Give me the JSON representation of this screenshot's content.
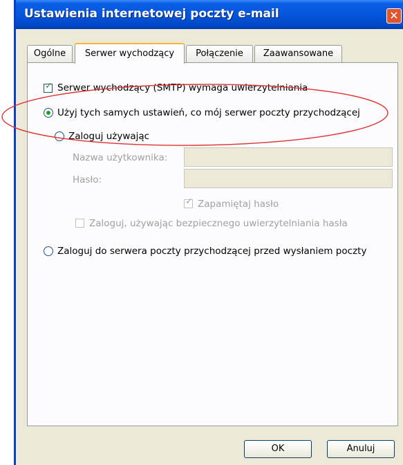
{
  "window": {
    "title": "Ustawienia internetowej poczty e-mail"
  },
  "tabs": [
    {
      "label": "Ogólne"
    },
    {
      "label": "Serwer wychodzący"
    },
    {
      "label": "Połączenie"
    },
    {
      "label": "Zaawansowane"
    }
  ],
  "active_tab": "Serwer wychodzący",
  "panel": {
    "smtp_auth_label": "Serwer wychodzący (SMTP) wymaga uwierzytelniania",
    "smtp_auth_checked": true,
    "use_same_settings_label": "Użyj tych samych ustawień, co mój serwer poczty przychodzącej",
    "use_same_settings_selected": true,
    "log_on_using_label": "Zaloguj używając",
    "username_label": "Nazwa użytkownika:",
    "username_value": "",
    "password_label": "Hasło:",
    "password_value": "",
    "remember_password_label": "Zapamiętaj hasło",
    "remember_password_checked": true,
    "spa_label": "Zaloguj, używając bezpiecznego uwierzytelniania hasła",
    "spa_checked": false,
    "log_on_before_label": "Zaloguj do serwera poczty przychodzącej przed wysłaniem poczty",
    "log_on_before_selected": false
  },
  "buttons": {
    "ok": "OK",
    "cancel": "Anuluj"
  },
  "annotation_color": "#e0302e"
}
